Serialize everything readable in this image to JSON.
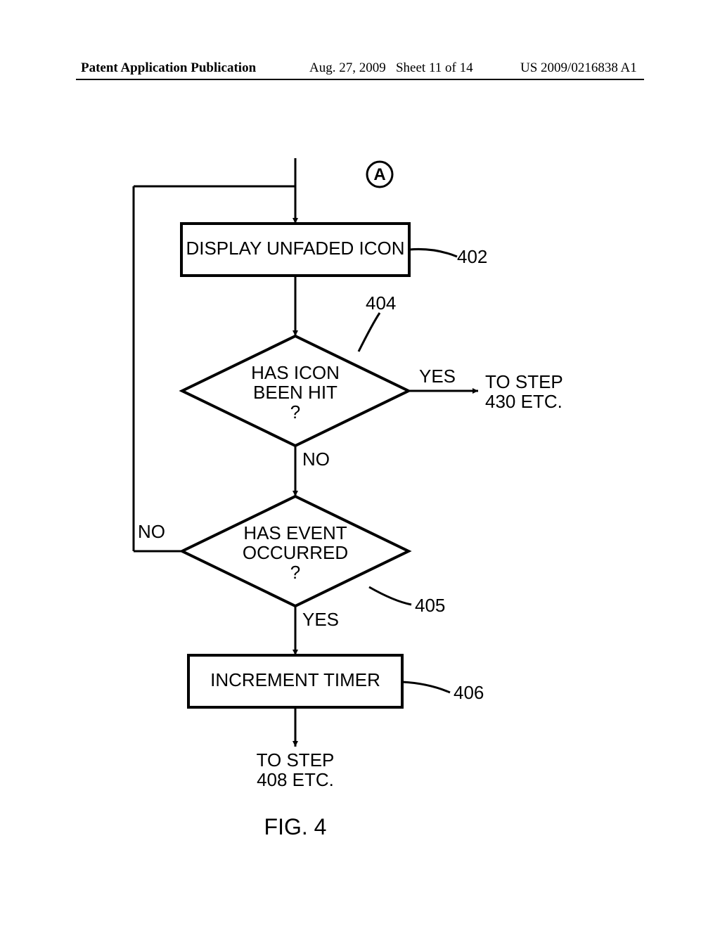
{
  "header": {
    "left": "Patent Application Publication",
    "date": "Aug. 27, 2009",
    "sheet": "Sheet 11 of 14",
    "pubno": "US 2009/0216838 A1"
  },
  "flow": {
    "connector_A": "A",
    "box_402": {
      "text": "DISPLAY UNFADED ICON",
      "ref": "402"
    },
    "dec_404": {
      "line1": "HAS ICON",
      "line2": "BEEN HIT",
      "line3": "?",
      "ref": "404",
      "yes": "YES",
      "yes_target_l1": "TO STEP",
      "yes_target_l2": "430 ETC.",
      "no": "NO"
    },
    "dec_405": {
      "line1": "HAS EVENT",
      "line2": "OCCURRED",
      "line3": "?",
      "ref": "405",
      "yes": "YES",
      "no": "NO"
    },
    "box_406": {
      "text": "INCREMENT TIMER",
      "ref": "406"
    },
    "exit": {
      "line1": "TO STEP",
      "line2": "408 ETC."
    }
  },
  "figure_label": "FIG. 4"
}
